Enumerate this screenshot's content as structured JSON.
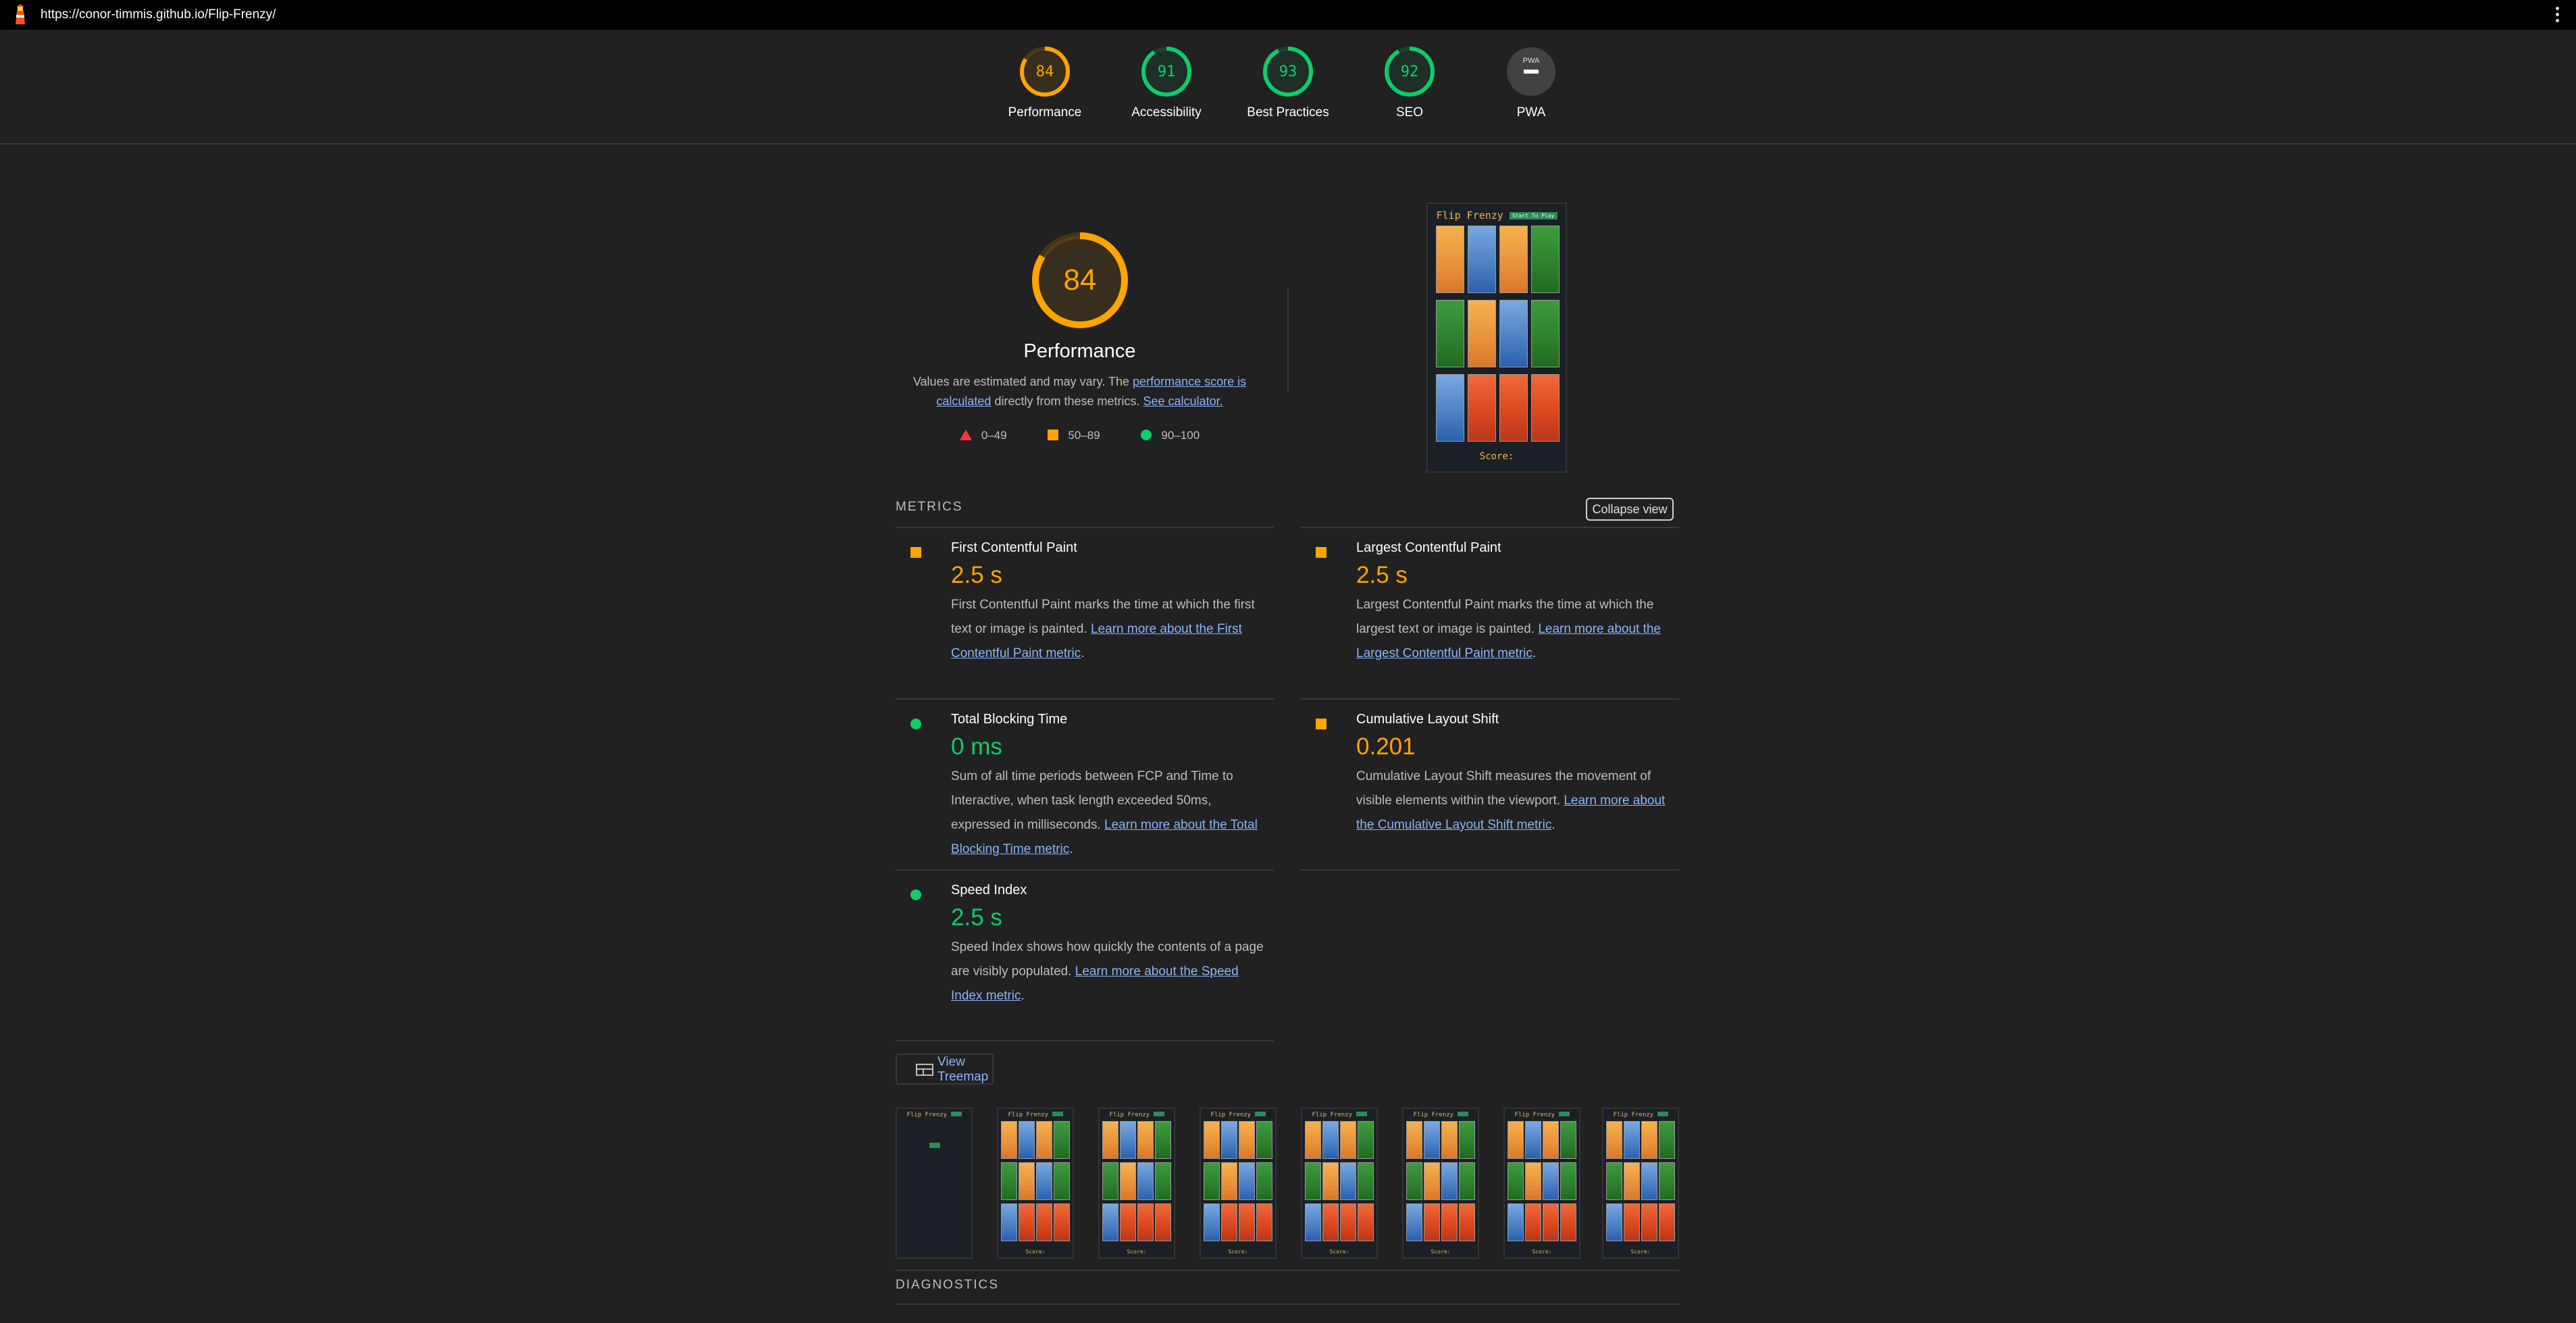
{
  "url": "https://conor-timmis.github.io/Flip-Frenzy/",
  "colors": {
    "fail": "#ff3333",
    "average": "#ffa400",
    "pass": "#0cce6b",
    "link": "#8ab4f8",
    "pwa": "#616161"
  },
  "categories": [
    {
      "id": "performance",
      "score": "84",
      "score_value": 84,
      "label": "Performance",
      "color": "#ffa400"
    },
    {
      "id": "accessibility",
      "score": "91",
      "score_value": 91,
      "label": "Accessibility",
      "color": "#0cce6b"
    },
    {
      "id": "best-practices",
      "score": "93",
      "score_value": 93,
      "label": "Best Practices",
      "color": "#0cce6b"
    },
    {
      "id": "seo",
      "score": "92",
      "score_value": 92,
      "label": "SEO",
      "color": "#0cce6b"
    },
    {
      "id": "pwa",
      "score": "PWA",
      "score_value": 0,
      "label": "PWA",
      "color": "#616161"
    }
  ],
  "performance": {
    "score": "84",
    "title": "Performance",
    "desc_prefix": "Values are estimated and may vary. The ",
    "desc_link1": "performance score is calculated",
    "desc_middle": " directly from these metrics. ",
    "desc_link2": "See calculator.",
    "legend": {
      "fail": "0–49",
      "average": "50–89",
      "pass": "90–100"
    }
  },
  "screenshot": {
    "title": "Flip Frenzy",
    "badge": "Start To Play",
    "score_label": "Score:"
  },
  "metrics": {
    "heading": "METRICS",
    "collapse_label": "Collapse view",
    "fcp": {
      "name": "First Contentful Paint",
      "value": "2.5 s",
      "desc": "First Contentful Paint marks the time at which the first text or image is painted. ",
      "link": "Learn more about the First Contentful Paint metric"
    },
    "lcp": {
      "name": "Largest Contentful Paint",
      "value": "2.5 s",
      "desc": "Largest Contentful Paint marks the time at which the largest text or image is painted. ",
      "link": "Learn more about the Largest Contentful Paint metric"
    },
    "tbt": {
      "name": "Total Blocking Time",
      "value": "0 ms",
      "desc": "Sum of all time periods between FCP and Time to Interactive, when task length exceeded 50ms, expressed in milliseconds. ",
      "link": "Learn more about the Total Blocking Time metric"
    },
    "cls": {
      "name": "Cumulative Layout Shift",
      "value": "0.201",
      "desc": "Cumulative Layout Shift measures the movement of visible elements within the viewport. ",
      "link": "Learn more about the Cumulative Layout Shift metric"
    },
    "si": {
      "name": "Speed Index",
      "value": "2.5 s",
      "desc": "Speed Index shows how quickly the contents of a page are visibly populated. ",
      "link": "Learn more about the Speed Index metric"
    }
  },
  "treemap_label": "View Treemap",
  "diagnostics_heading": "DIAGNOSTICS"
}
